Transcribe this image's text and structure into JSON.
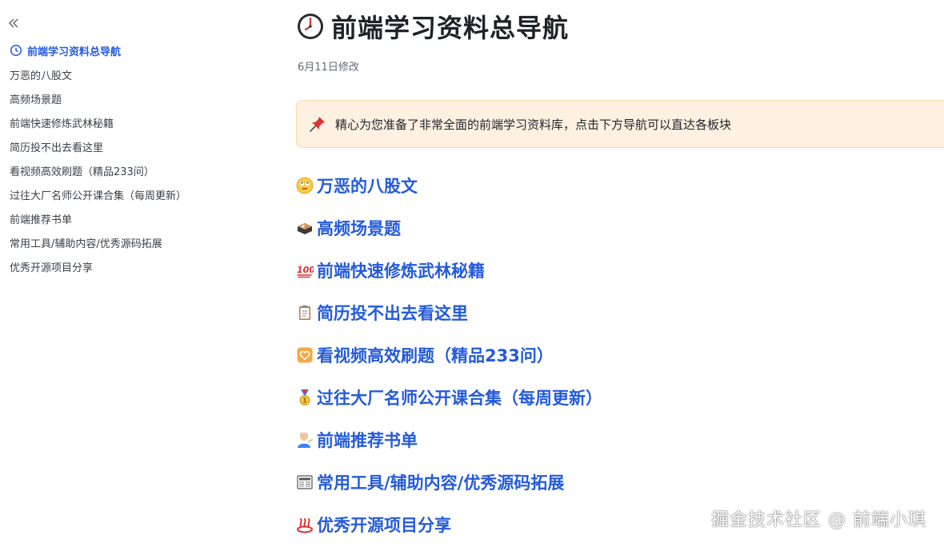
{
  "sidebar": {
    "items": [
      {
        "label": "前端学习资料总导航",
        "icon": "clock-icon",
        "active": true
      },
      {
        "label": "万恶的八股文"
      },
      {
        "label": "高频场景题"
      },
      {
        "label": "前端快速修炼武林秘籍"
      },
      {
        "label": "简历投不出去看这里"
      },
      {
        "label": "看视频高效刷题（精品233问）"
      },
      {
        "label": "过往大厂名师公开课合集（每周更新）"
      },
      {
        "label": "前端推荐书单"
      },
      {
        "label": "常用工具/辅助内容/优秀源码拓展"
      },
      {
        "label": "优秀开源项目分享"
      }
    ]
  },
  "page": {
    "title": "前端学习资料总导航",
    "title_icon": "clock-icon",
    "modified": "6月11日修改"
  },
  "callout": {
    "icon": "pushpin-icon",
    "text": "精心为您准备了非常全面的前端学习资料库，点击下方导航可以直达各板块"
  },
  "sections": [
    {
      "label": "万恶的八股文",
      "icon": "eye-roll-face-icon"
    },
    {
      "label": "高频场景题",
      "icon": "bento-box-icon"
    },
    {
      "label": "前端快速修炼武林秘籍",
      "icon": "hundred-points-icon"
    },
    {
      "label": "简历投不出去看这里",
      "icon": "clipboard-icon"
    },
    {
      "label": "看视频高效刷题（精品233问）",
      "icon": "heart-box-icon"
    },
    {
      "label": "过往大厂名师公开课合集（每周更新）",
      "icon": "medal-icon"
    },
    {
      "label": "前端推荐书单",
      "icon": "person-tipping-hand-icon"
    },
    {
      "label": "常用工具/辅助内容/优秀源码拓展",
      "icon": "newspaper-icon"
    },
    {
      "label": "优秀开源项目分享",
      "icon": "hot-springs-icon"
    }
  ],
  "watermark": "掘金技术社区 @ 前端小琪",
  "colors": {
    "link": "#245bdb",
    "callout_bg": "#fef1e1",
    "callout_border": "#fad8ad"
  }
}
